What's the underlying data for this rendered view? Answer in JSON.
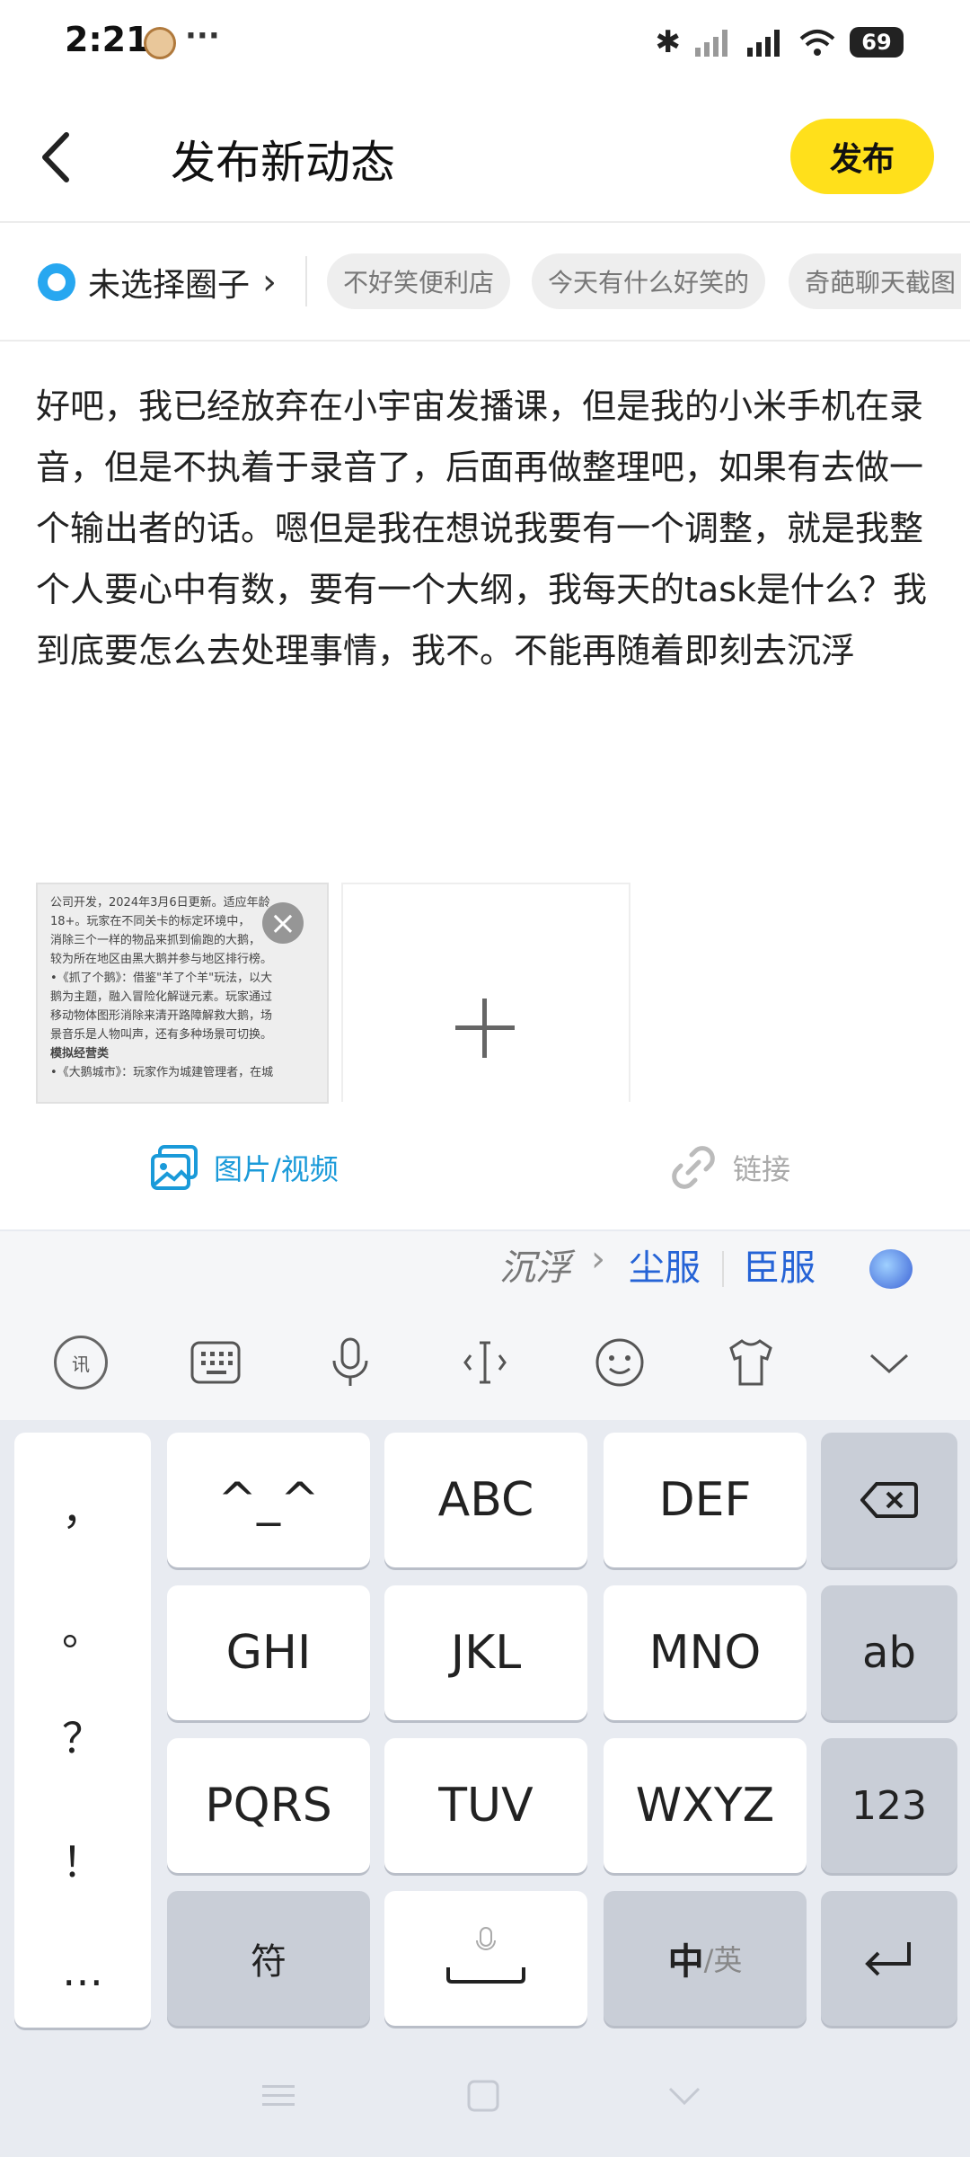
{
  "status_bar": {
    "time": "2:21",
    "dots": "···",
    "battery": "69"
  },
  "header": {
    "title": "发布新动态",
    "publish_label": "发布"
  },
  "circle": {
    "label": "未选择圈子",
    "chips": [
      "不好笑便利店",
      "今天有什么好笑的",
      "奇葩聊天截图"
    ]
  },
  "post": {
    "text": "好吧，我已经放弃在小宇宙发播课，但是我的小米手机在录音，但是不执着于录音了，后面再做整理吧，如果有去做一个输出者的话。嗯但是我在想说我要有一个调整，就是我整个人要心中有数，要有一个大纲，我每天的task是什么？我到底要怎么去处理事情，我不。不能再随着即刻去沉浮"
  },
  "media": {
    "thumb_lines": [
      "公司开发，2024年3月6日更新。适应年龄",
      "18+。玩家在不同关卡的标定环境中，",
      "消除三个一样的物品来抓到偷跑的大鹅，",
      "较为所在地区由黑大鹅并参与地区排行榜。",
      "•《抓了个鹅》：借鉴\"羊了个羊\"玩法，以大",
      "鹅为主题，融入冒险化解谜元素。玩家通过",
      "移动物体图形消除来清开路障解救大鹅，场",
      "景音乐是人物叫声，还有多种场景可切换。",
      "模拟经营类",
      "•《大鹅城市》：玩家作为城建管理者，在城"
    ],
    "close": "×"
  },
  "toolbar": {
    "media_label": "图片/视频",
    "link_label": "链接"
  },
  "ime": {
    "candidate_input": "沉浮",
    "candidate_arrow": "›",
    "candidates": [
      "尘服",
      "臣服"
    ],
    "punctuation": [
      "，",
      "。",
      "？",
      "！",
      "…"
    ],
    "keys_row1": [
      "^_^",
      "ABC",
      "DEF"
    ],
    "keys_row2": [
      "GHI",
      "JKL",
      "MNO"
    ],
    "keys_row3": [
      "PQRS",
      "TUV",
      "WXYZ"
    ],
    "side_keys": [
      "ab",
      "123"
    ],
    "symbol_key": "符",
    "lang_main": "中",
    "lang_alt": "/英"
  },
  "colors": {
    "accent_yellow": "#ffe01b",
    "link_blue": "#1a9ad9",
    "candidate_blue": "#2563d6"
  }
}
